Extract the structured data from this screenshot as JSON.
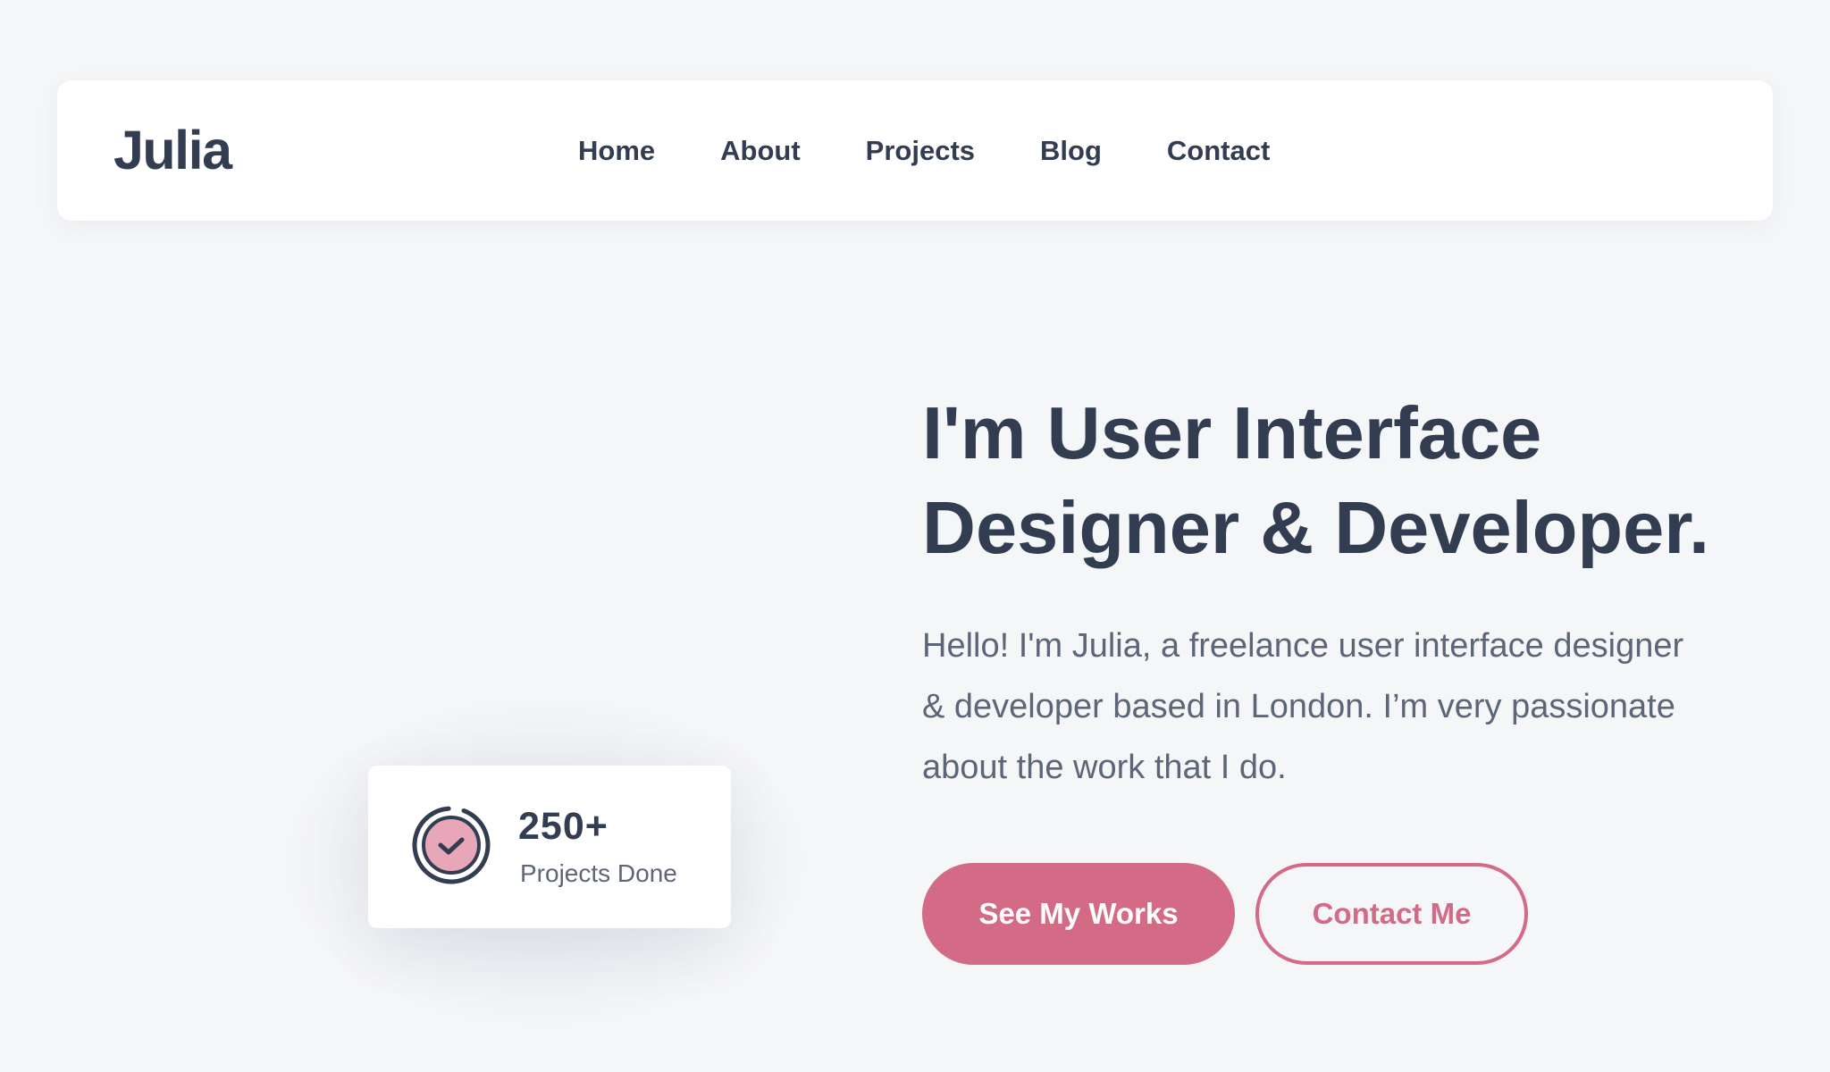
{
  "brand": {
    "logo": "Julia"
  },
  "nav": {
    "items": [
      {
        "label": "Home"
      },
      {
        "label": "About"
      },
      {
        "label": "Projects"
      },
      {
        "label": "Blog"
      },
      {
        "label": "Contact"
      }
    ]
  },
  "stat": {
    "value": "250+",
    "label": "Projects Done",
    "icon": "check-circle-icon"
  },
  "hero": {
    "title_line1": "I'm User Interface",
    "title_line2": "Designer & Developer.",
    "text_line1": "Hello! I'm Julia, a freelance user interface designer",
    "text_line2": "& developer based in London. I’m very passionate",
    "text_line3": "about the work that I do."
  },
  "buttons": {
    "primary_label": "See My Works",
    "secondary_label": "Contact Me"
  },
  "colors": {
    "accent": "#d36a86",
    "text_dark": "#323d52",
    "text_muted": "#5d6678",
    "background": "#f5f6f8",
    "card": "#ffffff"
  }
}
